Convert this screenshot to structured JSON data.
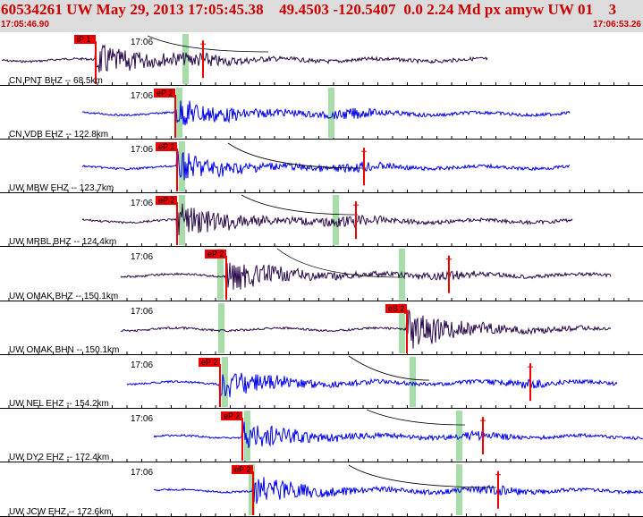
{
  "header": {
    "title": "60534261 UW May 29, 2013 17:05:45.38    49.4503 -120.5407  0.0 2.24 Md px amyw UW 01    3",
    "start_time": "17:05:46.90",
    "end_time": "17:06:53.26"
  },
  "colors": {
    "header_bg": "#dcdcdc",
    "title": "#cc0000",
    "trace_dark": "#2a0a4a",
    "trace_blue": "#0000ee",
    "pick_red": "#ee0000",
    "window_green": "#a8dca8"
  },
  "traces": [
    {
      "label": "CN PNT BHZ -- 68.5km",
      "time_label": "17:06",
      "pick_label": "iP 1",
      "color": "dark"
    },
    {
      "label": "CN VDB EHZ -- 122.8km",
      "time_label": "17:06",
      "pick_label": "eP 2",
      "color": "blue"
    },
    {
      "label": "UW MBW EHZ -- 123.7km",
      "time_label": "17:06",
      "pick_label": "eP 2",
      "color": "blue"
    },
    {
      "label": "UW MRBL BHZ -- 124.4km",
      "time_label": "17:06",
      "pick_label": "eP 2",
      "color": "dark"
    },
    {
      "label": "UW OMAK BHZ -- 150.1km",
      "time_label": "17:06",
      "pick_label": "eP 2",
      "color": "dark"
    },
    {
      "label": "UW OMAK BHN -- 150.1km",
      "time_label": "17:06",
      "pick_label": "eS 2",
      "color": "dark"
    },
    {
      "label": "UW NEL EHZ -- 154.2km",
      "time_label": "17:06",
      "pick_label": "eP 2",
      "color": "blue"
    },
    {
      "label": "UW DY2 EHZ -- 172.4km",
      "time_label": "17:06",
      "pick_label": "eP 2",
      "color": "blue"
    },
    {
      "label": "UW JCW EHZ -- 172.6km",
      "time_label": "17:06",
      "pick_label": "eP 2",
      "color": "blue"
    }
  ]
}
